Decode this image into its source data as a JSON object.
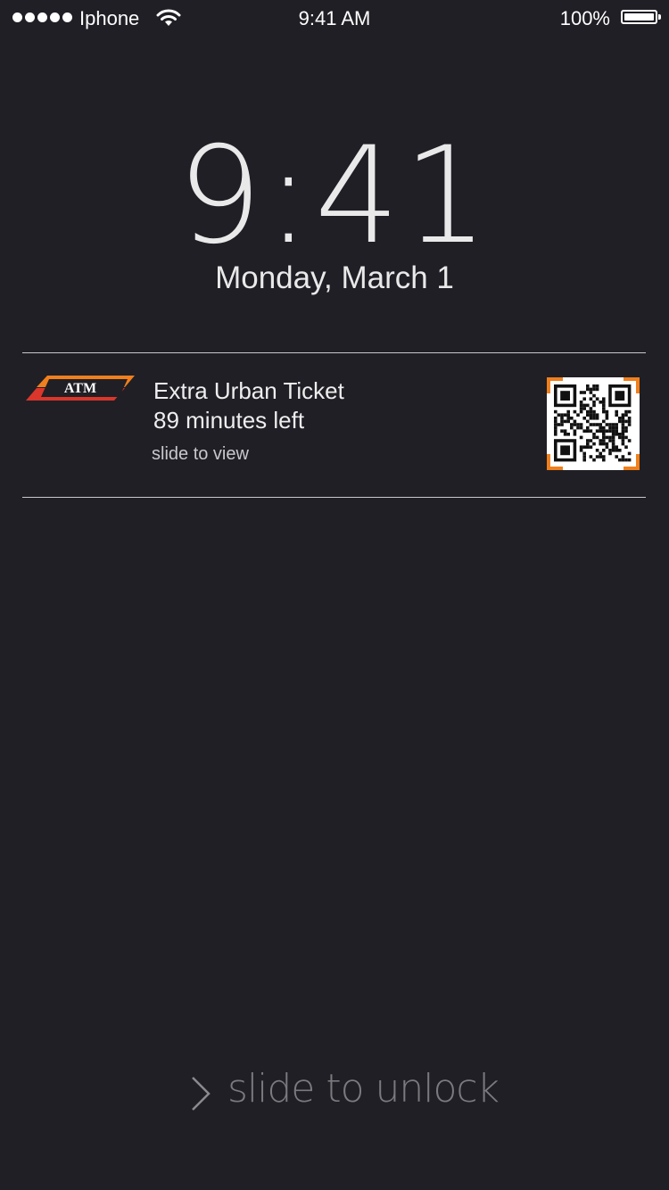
{
  "status_bar": {
    "carrier": "Iphone",
    "time": "9:41 AM",
    "battery": "100%",
    "battery_level": 1.0,
    "signal_bars": 5
  },
  "lock_screen": {
    "time": "9:41",
    "date": "Monday, March 1"
  },
  "notification": {
    "app_logo_text": "ATM",
    "title": "Extra Urban Ticket",
    "subtitle": "89 minutes left",
    "hint": "slide to view",
    "qr_icon": "qr-code-icon",
    "accent_color": "#f07f1d",
    "logo_red": "#d9362c"
  },
  "unlock": {
    "label": "slide to unlock",
    "icon": "chevron-right-icon"
  },
  "colors": {
    "background": "#201f25",
    "text": "#e9e9ea",
    "dim_text": "#7a7a7f"
  }
}
